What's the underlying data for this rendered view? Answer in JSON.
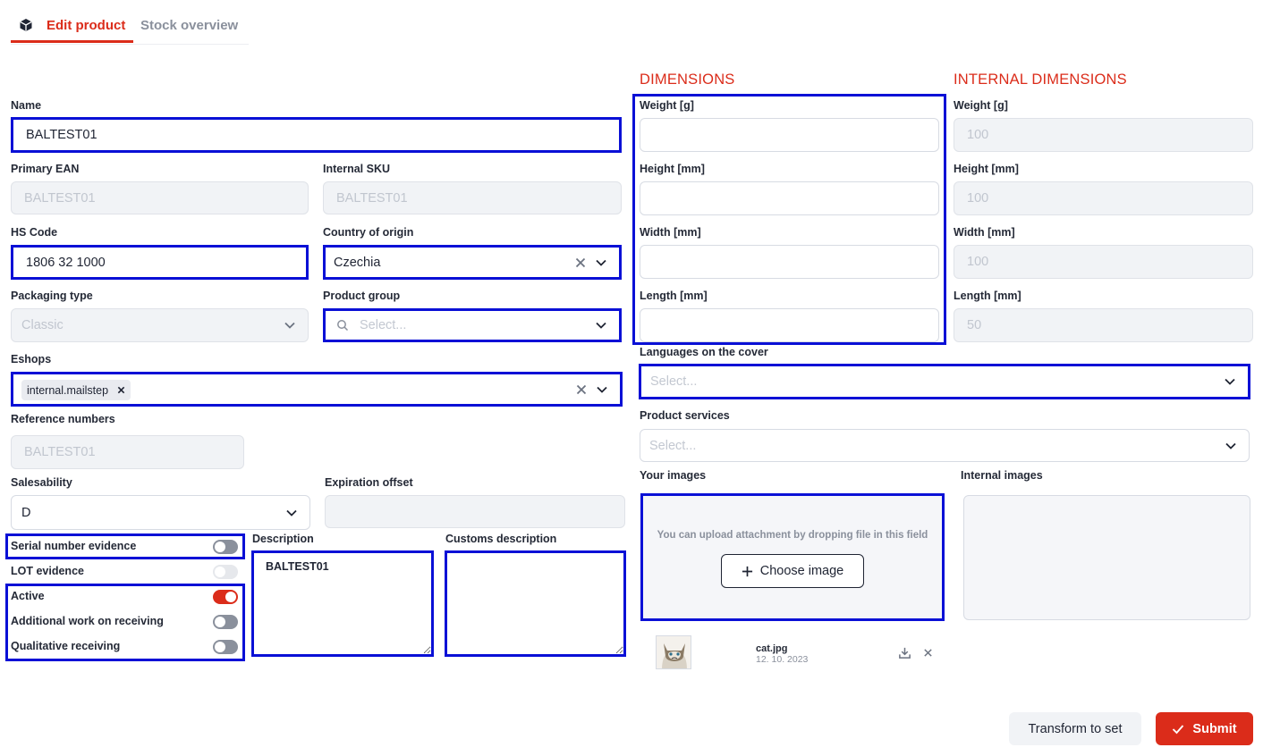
{
  "tabs": {
    "edit_product": "Edit product",
    "stock_overview": "Stock overview"
  },
  "colors": {
    "accent": "#db2c1a",
    "highlight": "#0a10d6"
  },
  "form": {
    "name": {
      "label": "Name",
      "value": "BALTEST01"
    },
    "primary_ean": {
      "label": "Primary EAN",
      "value": "BALTEST01"
    },
    "internal_sku": {
      "label": "Internal SKU",
      "value": "BALTEST01"
    },
    "hs_code": {
      "label": "HS Code",
      "value": "1806 32 1000"
    },
    "country_of_origin": {
      "label": "Country of origin",
      "value": "Czechia"
    },
    "packaging_type": {
      "label": "Packaging type",
      "value": "Classic"
    },
    "product_group": {
      "label": "Product group",
      "placeholder": "Select..."
    },
    "eshops": {
      "label": "Eshops",
      "tags": [
        "internal.mailstep"
      ]
    },
    "reference_numbers": {
      "label": "Reference numbers",
      "value": "BALTEST01"
    },
    "salesability": {
      "label": "Salesability",
      "value": "D"
    },
    "expiration_offset": {
      "label": "Expiration offset",
      "value": ""
    },
    "toggles": [
      {
        "label": "Serial number evidence",
        "state": "off"
      },
      {
        "label": "LOT evidence",
        "state": "disabled"
      },
      {
        "label": "Active",
        "state": "on"
      },
      {
        "label": "Additional work on receiving",
        "state": "off"
      },
      {
        "label": "Qualitative receiving",
        "state": "off"
      }
    ],
    "description": {
      "label": "Description",
      "value": "BALTEST01"
    },
    "customs_description": {
      "label": "Customs description",
      "value": ""
    }
  },
  "dimensions": {
    "title": "DIMENSIONS",
    "weight": {
      "label": "Weight [g]",
      "value": ""
    },
    "height": {
      "label": "Height [mm]",
      "value": ""
    },
    "width": {
      "label": "Width [mm]",
      "value": ""
    },
    "length": {
      "label": "Length [mm]",
      "value": ""
    }
  },
  "internal_dimensions": {
    "title": "INTERNAL DIMENSIONS",
    "weight": {
      "label": "Weight [g]",
      "value": "100"
    },
    "height": {
      "label": "Height [mm]",
      "value": "100"
    },
    "width": {
      "label": "Width [mm]",
      "value": "100"
    },
    "length": {
      "label": "Length [mm]",
      "value": "50"
    }
  },
  "languages_on_cover": {
    "label": "Languages on the cover",
    "placeholder": "Select..."
  },
  "product_services": {
    "label": "Product services",
    "placeholder": "Select..."
  },
  "your_images": {
    "label": "Your images",
    "drop_hint": "You can upload attachment by dropping file in this field",
    "choose_button": "Choose image",
    "file": {
      "name": "cat.jpg",
      "date": "12. 10. 2023"
    }
  },
  "internal_images": {
    "label": "Internal images"
  },
  "actions": {
    "transform": "Transform to set",
    "submit": "Submit"
  }
}
